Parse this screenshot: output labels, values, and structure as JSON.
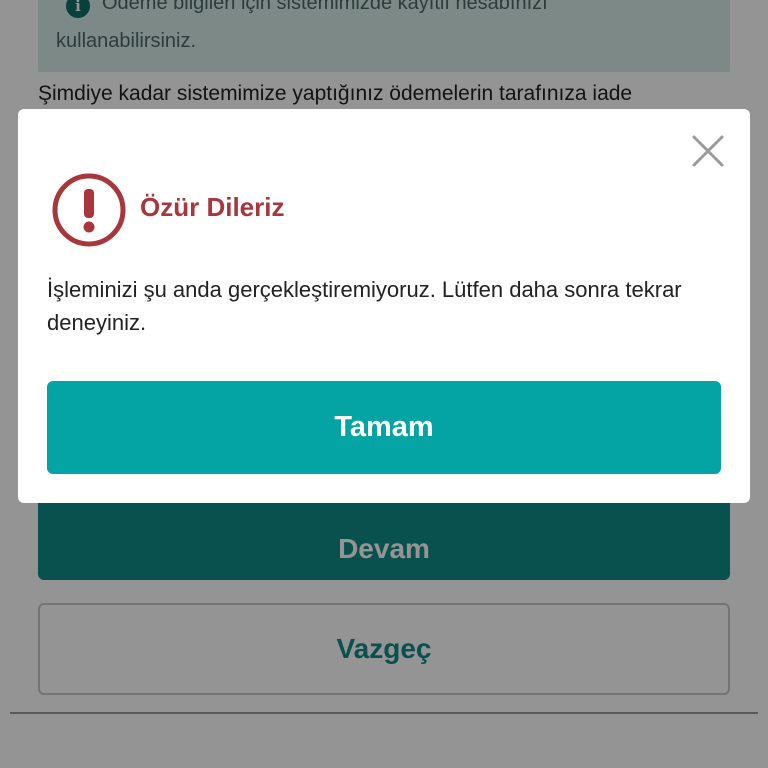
{
  "background": {
    "info_box": {
      "line1": "Ödeme bilgileri için sistemimizde kayıtlı hesabınızı",
      "line2": "kullanabilirsiniz.",
      "icon": "info-icon"
    },
    "body_text": "Şimdiye kadar sistemimize yaptığınız ödemelerin tarafınıza iade",
    "continue_label": "Devam",
    "cancel_label": "Vazgeç"
  },
  "modal": {
    "icon": "exclamation-circle-icon",
    "title": "Özür Dileriz",
    "message": "İşleminizi şu anda gerçekleştiremiyoruz. Lütfen daha sonra tekrar deneyiniz.",
    "ok_label": "Tamam",
    "close_icon": "close-icon"
  },
  "colors": {
    "accent": "#03a4a3",
    "error": "#a8373c",
    "overlay": "#000000"
  }
}
